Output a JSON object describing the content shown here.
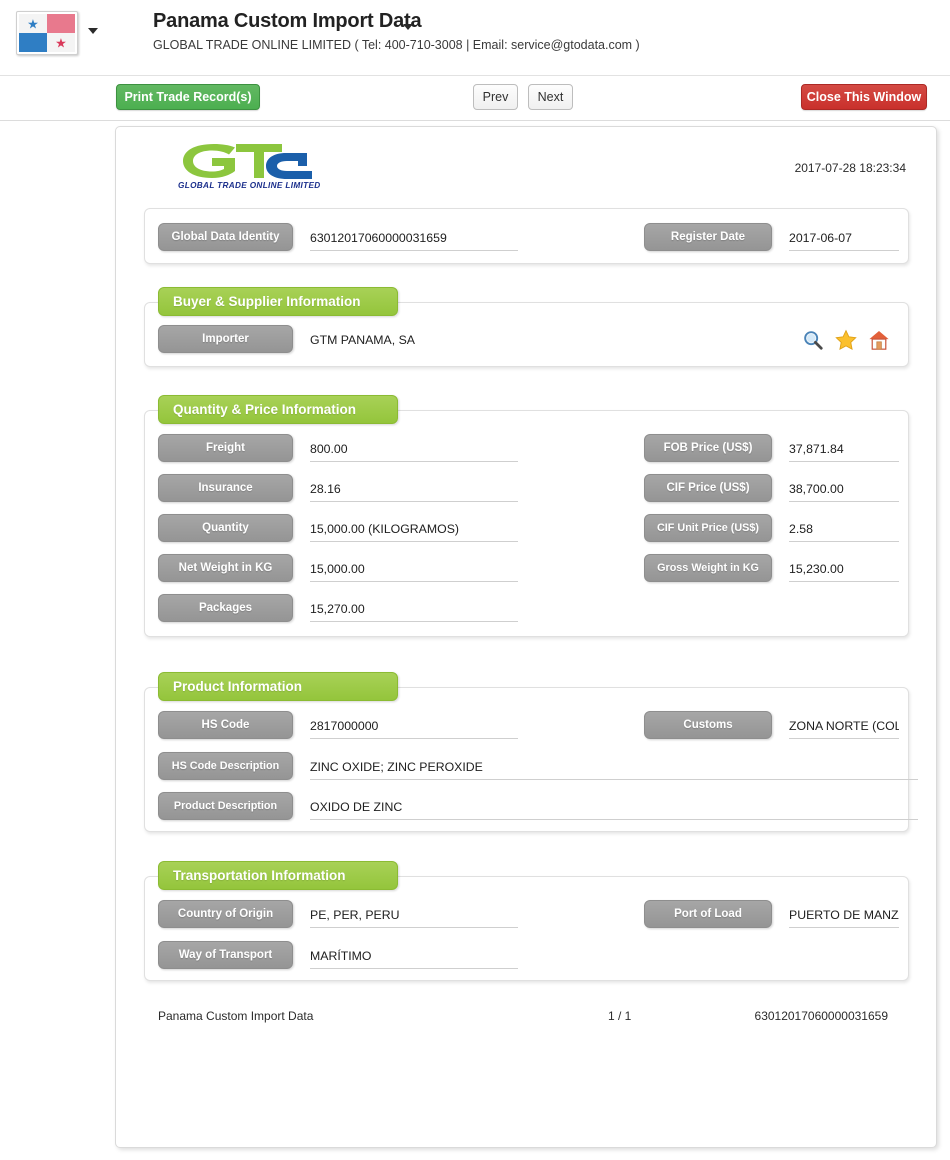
{
  "header": {
    "flag_icon": "panama-flag-icon",
    "flag_caret_icon": "chevron-down-icon",
    "title": "Panama Custom Import Data",
    "title_caret_icon": "chevron-down-icon",
    "subtitle": "GLOBAL TRADE ONLINE LIMITED ( Tel: 400-710-3008 | Email: service@gtodata.com )"
  },
  "toolbar": {
    "print_label": "Print Trade Record(s)",
    "prev_label": "Prev",
    "next_label": "Next",
    "close_label": "Close This Window",
    "colors": {
      "print_green": "#4caf50",
      "close_red": "#c9302c"
    }
  },
  "document": {
    "logo_caption": "GLOBAL TRADE  ONLINE LIMITED",
    "logo_green": "#8cc63e",
    "logo_blue": "#1b5faa",
    "timestamp": "2017-07-28 18:23:34",
    "identity_panel": {
      "fields": [
        {
          "label": "Global Data Identity",
          "value": "63012017060000031659"
        },
        {
          "label": "Register Date",
          "value": "2017-06-07"
        }
      ]
    },
    "sections": [
      {
        "title": "Buyer & Supplier Information",
        "fields": [
          {
            "label": "Importer",
            "value": "GTM PANAMA, SA"
          }
        ],
        "icons": [
          {
            "name": "search-icon",
            "glyph": "magnifier"
          },
          {
            "name": "favorite-star-icon",
            "glyph": "star"
          },
          {
            "name": "home-icon",
            "glyph": "house"
          }
        ]
      },
      {
        "title": "Quantity & Price Information",
        "fields_left": [
          {
            "label": "Freight",
            "value": "800.00"
          },
          {
            "label": "Insurance",
            "value": "28.16"
          },
          {
            "label": "Quantity",
            "value": "15,000.00 (KILOGRAMOS)"
          },
          {
            "label": "Net Weight in KG",
            "value": "15,000.00"
          },
          {
            "label": "Packages",
            "value": "15,270.00"
          }
        ],
        "fields_right": [
          {
            "label": "FOB Price (US$)",
            "value": "37,871.84"
          },
          {
            "label": "CIF Price (US$)",
            "value": "38,700.00"
          },
          {
            "label": "CIF Unit Price (US$)",
            "value": "2.58"
          },
          {
            "label": "Gross Weight in KG",
            "value": "15,230.00"
          }
        ]
      },
      {
        "title": "Product Information",
        "fields_left": [
          {
            "label": "HS Code",
            "value": "2817000000"
          }
        ],
        "fields_right": [
          {
            "label": "Customs",
            "value": "ZONA NORTE (COLON)"
          }
        ],
        "fields_wide": [
          {
            "label": "HS Code Description",
            "value": "ZINC OXIDE; ZINC PEROXIDE"
          },
          {
            "label": "Product Description",
            "value": "OXIDO DE ZINC"
          }
        ]
      },
      {
        "title": "Transportation Information",
        "fields_left": [
          {
            "label": "Country of Origin",
            "value": "PE, PER, PERU"
          },
          {
            "label": "Way of Transport",
            "value": "MARÍTIMO"
          }
        ],
        "fields_right": [
          {
            "label": "Port of Load",
            "value": "PUERTO DE MANZANILLO"
          }
        ]
      }
    ],
    "footer": {
      "left": "Panama Custom Import Data",
      "center": "1 / 1",
      "right": "63012017060000031659"
    }
  }
}
